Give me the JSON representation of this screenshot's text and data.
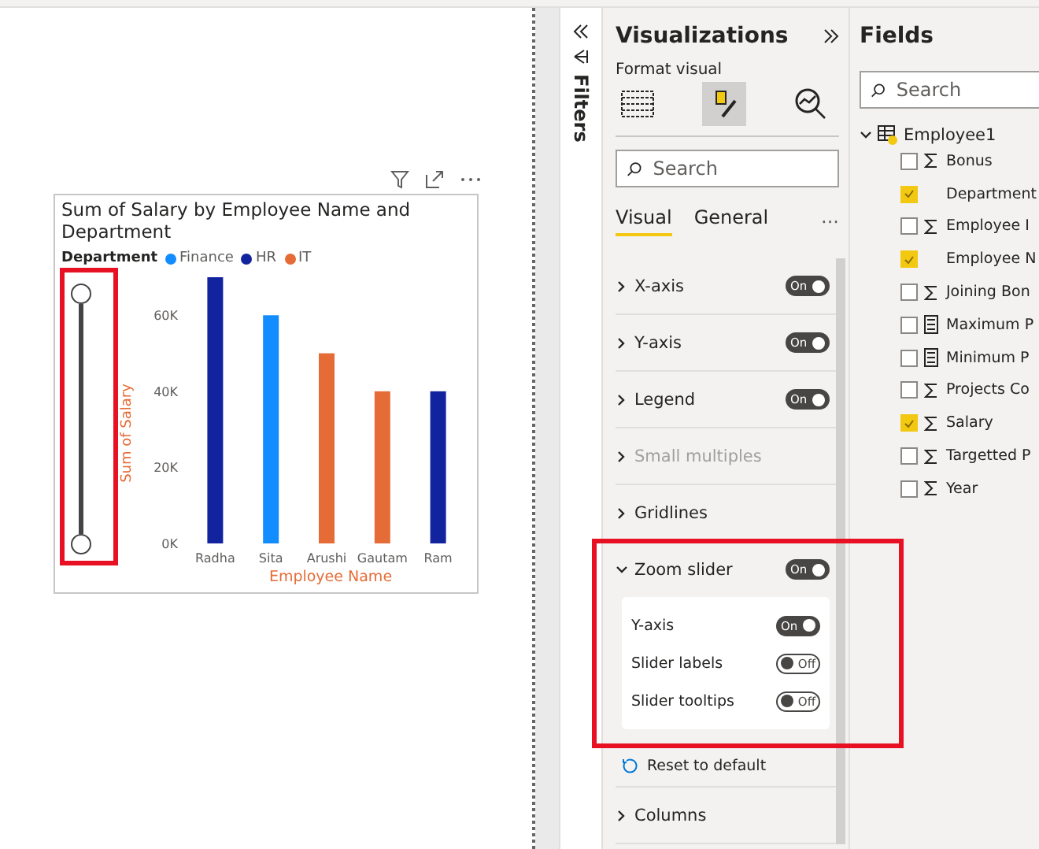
{
  "chart": {
    "title": "Sum of Salary by Employee Name and Department",
    "legend_title": "Department",
    "chart_data": {
      "type": "bar",
      "xlabel": "Employee Name",
      "ylabel": "Sum of Salary",
      "categories": [
        "Radha",
        "Sita",
        "Arushi",
        "Gautam",
        "Ram"
      ],
      "series": [
        {
          "name": "Finance",
          "color": "#118dff",
          "values": [
            null,
            60000,
            null,
            null,
            null
          ]
        },
        {
          "name": "HR",
          "color": "#12239e",
          "values": [
            70000,
            null,
            null,
            null,
            40000
          ]
        },
        {
          "name": "IT",
          "color": "#e66c37",
          "values": [
            null,
            null,
            50000,
            40000,
            null
          ]
        }
      ],
      "ylim": [
        0,
        70000
      ],
      "yticks": [
        {
          "value": 0,
          "label": "0K"
        },
        {
          "value": 20000,
          "label": "20K"
        },
        {
          "value": 40000,
          "label": "40K"
        },
        {
          "value": 60000,
          "label": "60K"
        }
      ]
    },
    "zoom_slider": {
      "level": 1
    }
  },
  "filters_pane": {
    "label": "Filters"
  },
  "visualizations": {
    "title": "Visualizations",
    "subtitle": "Format visual",
    "search": {
      "placeholder": "Search"
    },
    "tabs": [
      {
        "label": "Visual",
        "selected": true
      },
      {
        "label": "General",
        "selected": false
      }
    ],
    "more": "···",
    "sections": [
      {
        "label": "X-axis",
        "expanded": false,
        "disabled": false,
        "toggle": {
          "label": "On",
          "on": true
        }
      },
      {
        "label": "Y-axis",
        "expanded": false,
        "disabled": false,
        "toggle": {
          "label": "On",
          "on": true
        }
      },
      {
        "label": "Legend",
        "expanded": false,
        "disabled": false,
        "toggle": {
          "label": "On",
          "on": true
        }
      },
      {
        "label": "Small multiples",
        "expanded": false,
        "disabled": true
      },
      {
        "label": "Gridlines",
        "expanded": false,
        "disabled": false
      },
      {
        "label": "Zoom slider",
        "expanded": true,
        "disabled": false,
        "toggle": {
          "label": "On",
          "on": true
        },
        "options": [
          {
            "label": "Y-axis",
            "toggle": {
              "label": "On",
              "on": true
            }
          },
          {
            "label": "Slider labels",
            "toggle": {
              "label": "Off",
              "on": false
            }
          },
          {
            "label": "Slider tooltips",
            "toggle": {
              "label": "Off",
              "on": false
            }
          }
        ],
        "reset": "Reset to default"
      },
      {
        "label": "Columns",
        "expanded": false,
        "disabled": false
      }
    ]
  },
  "fields": {
    "title": "Fields",
    "search": {
      "placeholder": "Search"
    },
    "table": "Employee1",
    "items": [
      {
        "label": "Bonus",
        "checked": false,
        "kind": "sum"
      },
      {
        "label": "Department",
        "checked": true,
        "kind": "text"
      },
      {
        "label": "Employee I",
        "checked": false,
        "kind": "sum"
      },
      {
        "label": "Employee N",
        "checked": true,
        "kind": "text"
      },
      {
        "label": "Joining Bon",
        "checked": false,
        "kind": "sum"
      },
      {
        "label": "Maximum P",
        "checked": false,
        "kind": "measure"
      },
      {
        "label": "Minimum P",
        "checked": false,
        "kind": "measure"
      },
      {
        "label": "Projects Co",
        "checked": false,
        "kind": "sum"
      },
      {
        "label": "Salary",
        "checked": true,
        "kind": "sum"
      },
      {
        "label": "Targetted P",
        "checked": false,
        "kind": "sum"
      },
      {
        "label": "Year",
        "checked": false,
        "kind": "sum"
      }
    ]
  }
}
